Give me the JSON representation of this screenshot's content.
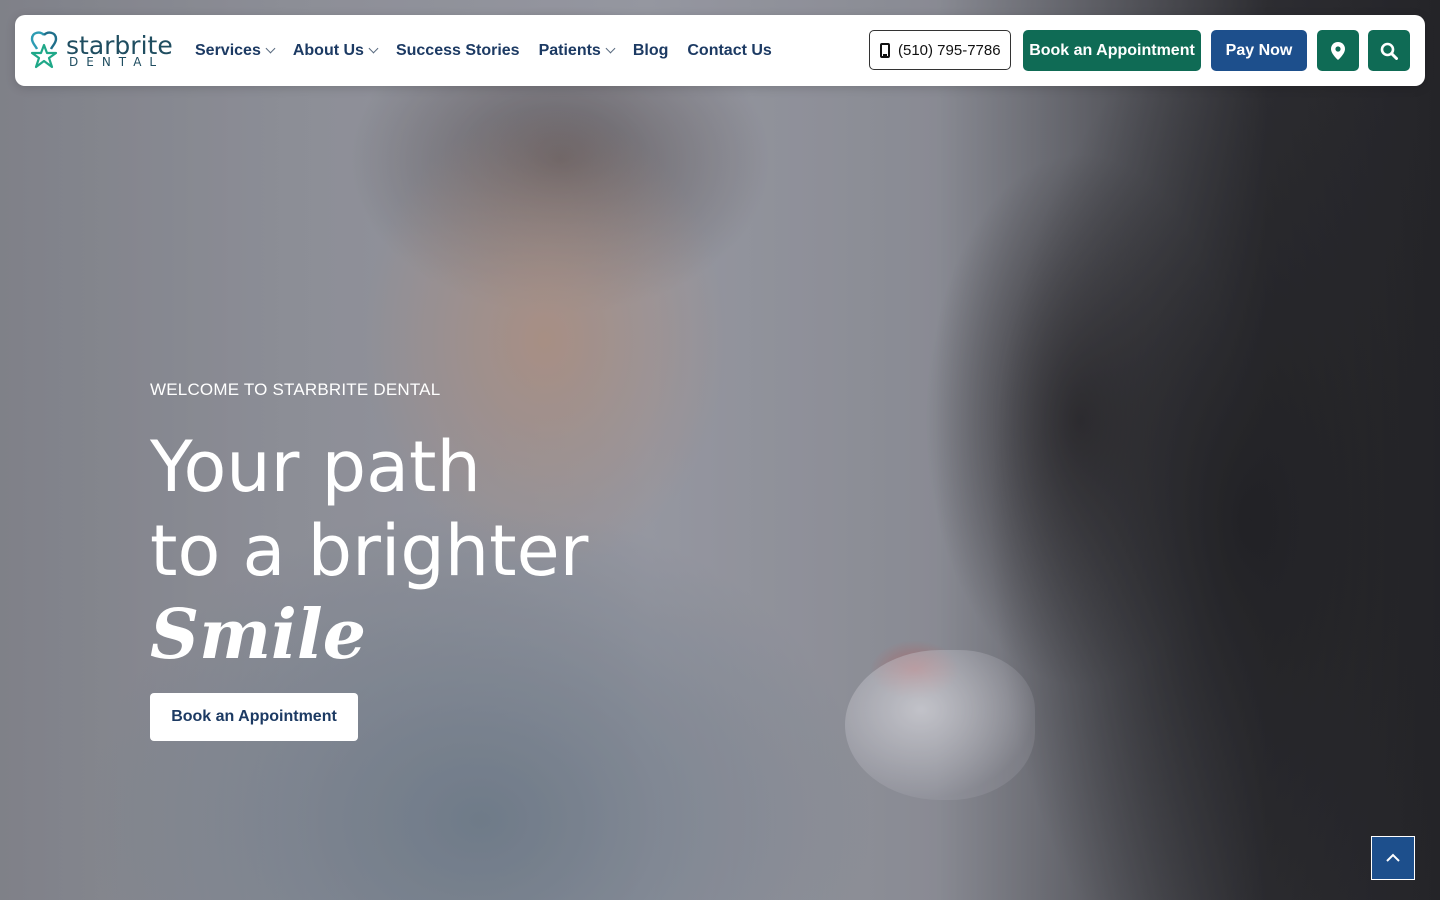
{
  "brand": {
    "name": "starbrite",
    "subtitle": "DENTAL"
  },
  "nav": {
    "items": [
      {
        "label": "Services",
        "has_dropdown": true
      },
      {
        "label": "About Us",
        "has_dropdown": true
      },
      {
        "label": "Success Stories",
        "has_dropdown": false
      },
      {
        "label": "Patients",
        "has_dropdown": true
      },
      {
        "label": "Blog",
        "has_dropdown": false
      },
      {
        "label": "Contact Us",
        "has_dropdown": false
      }
    ]
  },
  "header_actions": {
    "phone": "(510) 795-7786",
    "book_label": "Book an Appointment",
    "pay_label": "Pay Now",
    "location_icon": "map-pin-icon",
    "search_icon": "search-icon"
  },
  "hero": {
    "eyebrow": "WELCOME TO STARBRITE DENTAL",
    "title_line1": "Your path",
    "title_line2": "to a brighter",
    "title_line3": "Smile",
    "cta_label": "Book an Appointment"
  },
  "scroll_top_icon": "chevron-up-icon",
  "colors": {
    "primary_green": "#0f6b55",
    "primary_blue": "#1d4f8c",
    "nav_text": "#1c3a63",
    "logo_teal": "#1f4d60"
  }
}
